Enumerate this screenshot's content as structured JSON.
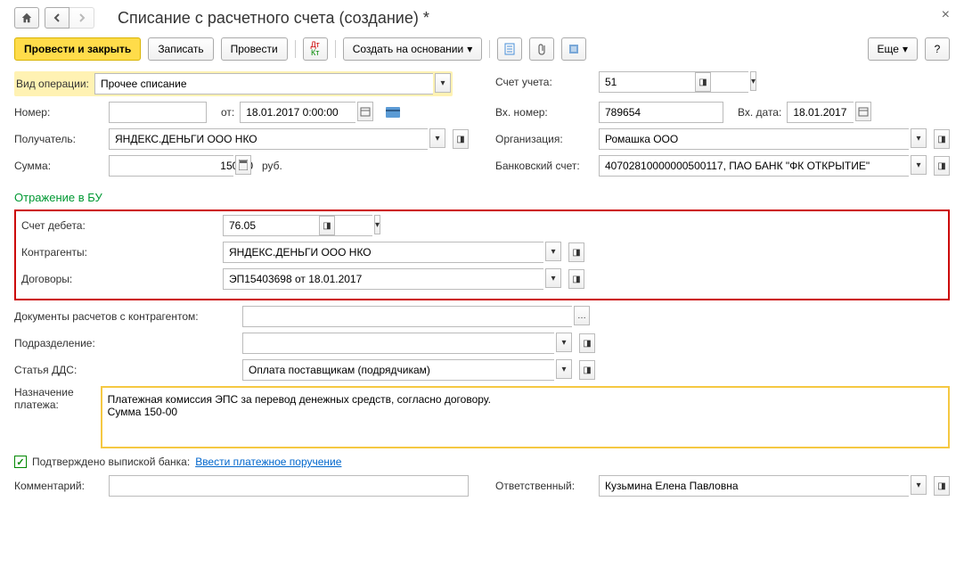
{
  "title": "Списание с расчетного счета (создание) *",
  "toolbar": {
    "submit_close": "Провести и закрыть",
    "save": "Записать",
    "submit": "Провести",
    "create_based": "Создать на основании",
    "more": "Еще",
    "help": "?"
  },
  "fields": {
    "operation_type_label": "Вид операции:",
    "operation_type": "Прочее списание",
    "account_label": "Счет учета:",
    "account": "51",
    "number_label": "Номер:",
    "number": "",
    "from_label": "от:",
    "date": "18.01.2017 0:00:00",
    "in_number_label": "Вх. номер:",
    "in_number": "789654",
    "in_date_label": "Вх. дата:",
    "in_date": "18.01.2017",
    "recipient_label": "Получатель:",
    "recipient": "ЯНДЕКС.ДЕНЬГИ ООО НКО",
    "organization_label": "Организация:",
    "organization": "Ромашка ООО",
    "sum_label": "Сумма:",
    "sum": "150,00",
    "currency": "руб.",
    "bank_account_label": "Банковский счет:",
    "bank_account": "40702810000000500117, ПАО БАНК \"ФК ОТКРЫТИЕ\""
  },
  "bu": {
    "section_title": "Отражение в БУ",
    "debit_account_label": "Счет дебета:",
    "debit_account": "76.05",
    "counterparty_label": "Контрагенты:",
    "counterparty": "ЯНДЕКС.ДЕНЬГИ ООО НКО",
    "contract_label": "Договоры:",
    "contract": "ЭП15403698 от 18.01.2017",
    "settlement_docs_label": "Документы расчетов с контрагентом:",
    "settlement_docs": "",
    "division_label": "Подразделение:",
    "division": "",
    "dds_label": "Статья ДДС:",
    "dds": "Оплата поставщикам (подрядчикам)",
    "purpose_label": "Назначение платежа:",
    "purpose": "Платежная комиссия ЭПС за перевод денежных средств, согласно договору.\nСумма 150-00"
  },
  "footer": {
    "confirmed_label": "Подтверждено выпиской банка:",
    "enter_order_link": "Ввести платежное поручение",
    "comment_label": "Комментарий:",
    "comment": "",
    "responsible_label": "Ответственный:",
    "responsible": "Кузьмина Елена Павловна"
  }
}
